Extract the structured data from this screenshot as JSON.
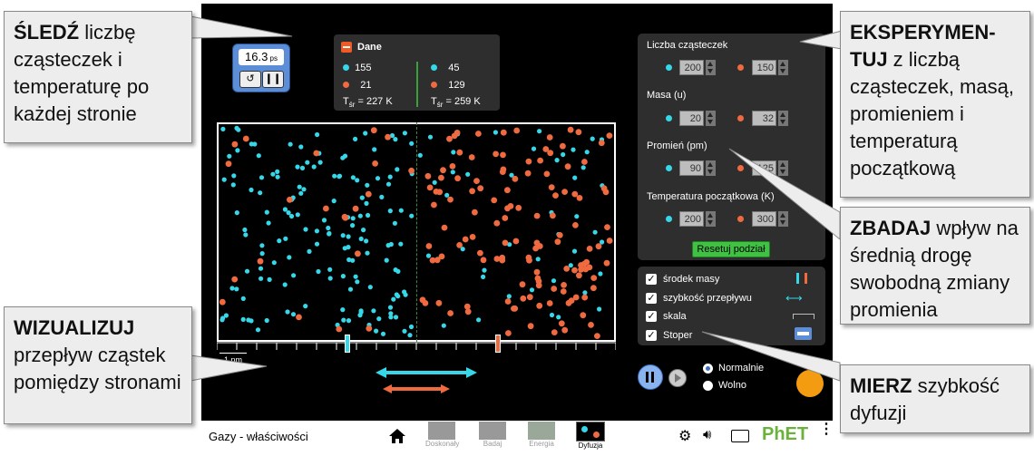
{
  "callouts": {
    "track": {
      "bold": "ŚLEDŹ",
      "text": " liczbę cząsteczek i temperaturę po każdej stronie"
    },
    "visualize": {
      "bold": "WIZUALIZUJ",
      "text": " przepływ cząstek pomiędzy stronami"
    },
    "experiment": {
      "bold": "EKSPERYMEN-TUJ",
      "text": " z liczbą cząsteczek, masą, promieniem i temperaturą początkową"
    },
    "explore": {
      "bold": "ZBADAJ",
      "text": " wpływ na średnią drogę swobodną zmiany promienia"
    },
    "measure": {
      "bold": "MIERZ",
      "text": " szybkość dyfuzji"
    }
  },
  "stopwatch": {
    "value": "16.3",
    "unit": "ps"
  },
  "data_panel": {
    "title": "Dane",
    "left": {
      "cyan": "155",
      "orange": "21",
      "temp_label": "T",
      "temp_sub": "śr",
      "temp": "= 227 K"
    },
    "right": {
      "cyan": "45",
      "orange": "129",
      "temp_label": "T",
      "temp_sub": "śr",
      "temp": "= 259 K"
    }
  },
  "scale_label": "1 nm",
  "controls": {
    "count_label": "Liczba cząsteczek",
    "count": {
      "cyan": "200",
      "orange": "150"
    },
    "mass_label": "Masa (u)",
    "mass": {
      "cyan": "20",
      "orange": "32"
    },
    "radius_label": "Promień (pm)",
    "radius": {
      "cyan": "90",
      "orange": "125"
    },
    "temp_label": "Temperatura początkowa (K)",
    "temp": {
      "cyan": "200",
      "orange": "300"
    },
    "reset_label": "Resetuj podział"
  },
  "options": [
    {
      "label": "środek masy",
      "checked": true
    },
    {
      "label": "szybkość przepływu",
      "checked": true
    },
    {
      "label": "skala",
      "checked": true
    },
    {
      "label": "Stoper",
      "checked": true
    }
  ],
  "speed": {
    "normal": "Normalnie",
    "slow": "Wolno",
    "selected": "Normalnie"
  },
  "nav": {
    "title": "Gazy - właściwości",
    "screens": [
      "Doskonały",
      "Badaj",
      "Energia",
      "Dyfuzja"
    ],
    "active": "Dyfuzja",
    "logo": "PhET"
  },
  "colors": {
    "cyan": "#36d7e8",
    "orange": "#f06a40",
    "panel": "#2e2e2e",
    "reset": "#41c144"
  }
}
